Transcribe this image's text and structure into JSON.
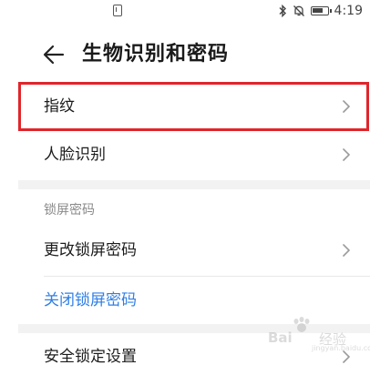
{
  "status_bar": {
    "notification_icon": "sim-card-icon",
    "bluetooth_glyph": "✻",
    "mute_glyph": "🔕",
    "time": "4:19"
  },
  "header": {
    "back_icon": "back-arrow-icon",
    "title": "生物识别和密码"
  },
  "items": {
    "fingerprint": {
      "label": "指纹",
      "highlighted": true,
      "highlight_color": "#e0252b"
    },
    "face_recognition": {
      "label": "人脸识别"
    },
    "lock_section_header": "锁屏密码",
    "change_lock_password": {
      "label": "更改锁屏密码"
    },
    "disable_lock_password": {
      "label": "关闭锁屏密码",
      "color": "#2f7fe6"
    },
    "security_lock_settings": {
      "label": "安全锁定设置"
    }
  },
  "watermark": {
    "brand_left": "Bai",
    "brand_right": "经验",
    "sub": "jingyan.baidu.com"
  }
}
